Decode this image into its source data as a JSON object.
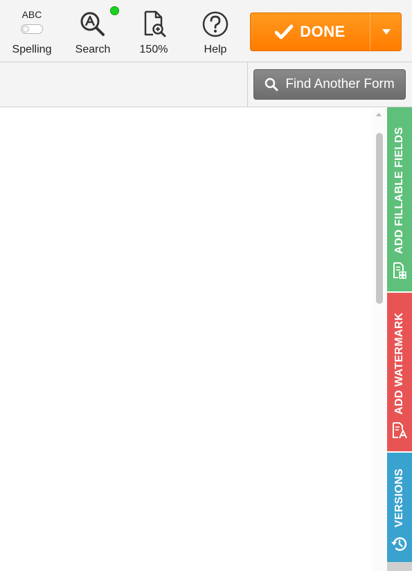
{
  "toolbar": {
    "spelling": {
      "badge": "ABC",
      "label": "Spelling"
    },
    "search": {
      "label": "Search"
    },
    "zoom": {
      "label": "150%"
    },
    "help": {
      "label": "Help"
    },
    "done": {
      "label": "DONE"
    }
  },
  "subbar": {
    "find_label": "Find Another Form"
  },
  "side_tabs": {
    "fields": {
      "label": "ADD FILLABLE FIELDS",
      "color": "#5ec07a"
    },
    "watermark": {
      "label": "ADD WATERMARK",
      "color": "#e85454"
    },
    "versions": {
      "label": "VERSIONS",
      "color": "#3aa2cf"
    }
  },
  "colors": {
    "accent": "#ff8a00",
    "status_dot": "#19d21e"
  }
}
